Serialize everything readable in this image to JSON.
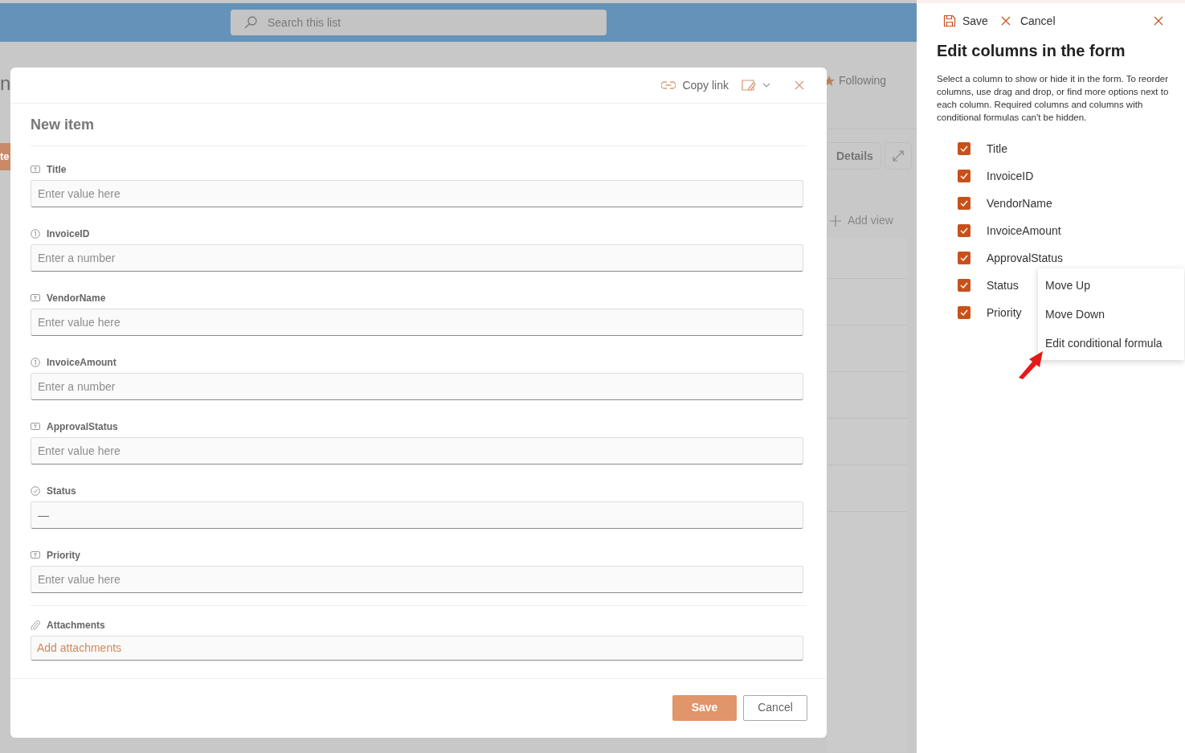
{
  "background": {
    "search": {
      "placeholder": "Search this list"
    },
    "title_fragment": "n",
    "button_fragment": "te",
    "follow": {
      "label": "Following"
    },
    "details": {
      "label": "Details"
    },
    "add_view": {
      "label": "Add view"
    }
  },
  "dialog": {
    "toolbar": {
      "copy_link": "Copy link"
    },
    "title": "New item",
    "fields": [
      {
        "kind": "text",
        "label": "Title",
        "placeholder": "Enter value here"
      },
      {
        "kind": "number",
        "label": "InvoiceID",
        "placeholder": "Enter a number"
      },
      {
        "kind": "text",
        "label": "VendorName",
        "placeholder": "Enter value here"
      },
      {
        "kind": "number",
        "label": "InvoiceAmount",
        "placeholder": "Enter a number"
      },
      {
        "kind": "text",
        "label": "ApprovalStatus",
        "placeholder": "Enter value here"
      },
      {
        "kind": "choice",
        "label": "Status",
        "value": "—"
      },
      {
        "kind": "text",
        "label": "Priority",
        "placeholder": "Enter value here"
      }
    ],
    "attachments": {
      "label": "Attachments",
      "link": "Add attachments"
    },
    "buttons": [
      {
        "kind": "primary",
        "label": "Save"
      },
      {
        "kind": "secondary",
        "label": "Cancel"
      }
    ]
  },
  "panel": {
    "toolbar": {
      "save": "Save",
      "cancel": "Cancel"
    },
    "title": "Edit columns in the form",
    "description": "Select a column to show or hide it in the form. To reorder columns, use drag and drop, or find more options next to each column. Required columns and columns with conditional formulas can't be hidden.",
    "columns": [
      {
        "label": "Title",
        "checked": true
      },
      {
        "label": "InvoiceID",
        "checked": true
      },
      {
        "label": "VendorName",
        "checked": true
      },
      {
        "label": "InvoiceAmount",
        "checked": true
      },
      {
        "label": "ApprovalStatus",
        "checked": true
      },
      {
        "label": "Status",
        "checked": true
      },
      {
        "label": "Priority",
        "checked": true
      }
    ],
    "context_menu": {
      "items": [
        "Move Up",
        "Move Down",
        "Edit conditional formula"
      ]
    }
  }
}
